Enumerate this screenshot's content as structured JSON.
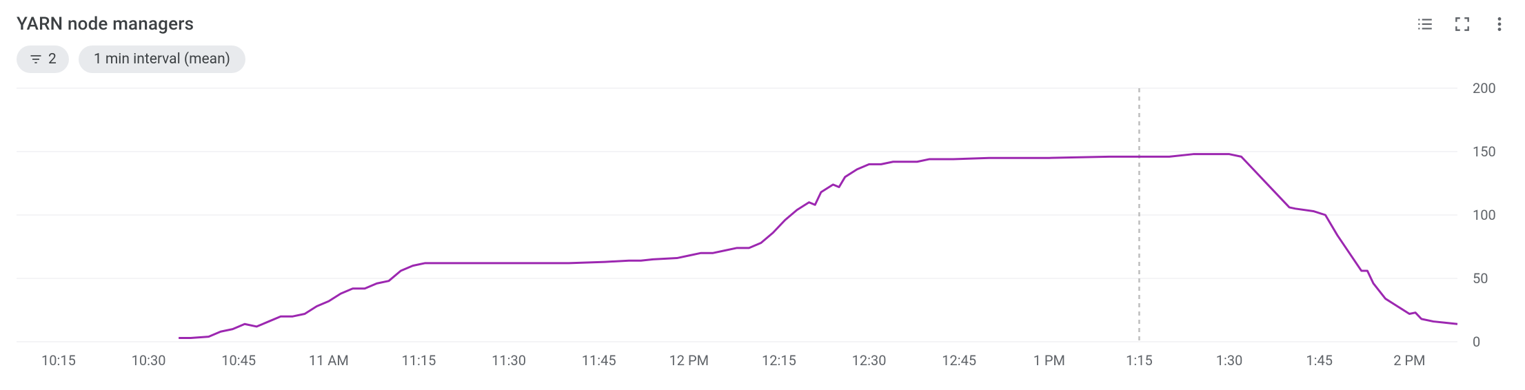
{
  "header": {
    "title": "YARN node managers"
  },
  "chips": {
    "filter_count": "2",
    "interval_label": "1 min interval (mean)"
  },
  "icons": {
    "legend": "legend-icon",
    "fullscreen": "fullscreen-icon",
    "more": "more-vert-icon"
  },
  "colors": {
    "series": "#9c27b0",
    "grid": "#e8eaed",
    "axis_text": "#5f6368"
  },
  "chart_data": {
    "type": "line",
    "title": "YARN node managers",
    "xlabel": "",
    "ylabel": "",
    "ylim": [
      0,
      200
    ],
    "y_ticks": [
      0,
      50,
      100,
      150,
      200
    ],
    "x_ticks": [
      "10:15",
      "10:30",
      "10:45",
      "11 AM",
      "11:15",
      "11:30",
      "11:45",
      "12 PM",
      "12:15",
      "12:30",
      "12:45",
      "1 PM",
      "1:15",
      "1:30",
      "1:45",
      "2 PM"
    ],
    "x_range_minutes": [
      608,
      848
    ],
    "marker_x_minute": 795,
    "series": [
      {
        "name": "node_managers",
        "color": "#9c27b0",
        "points": [
          [
            635,
            3
          ],
          [
            637,
            3
          ],
          [
            640,
            4
          ],
          [
            642,
            8
          ],
          [
            644,
            10
          ],
          [
            646,
            14
          ],
          [
            648,
            12
          ],
          [
            650,
            16
          ],
          [
            652,
            20
          ],
          [
            654,
            20
          ],
          [
            656,
            22
          ],
          [
            658,
            28
          ],
          [
            660,
            32
          ],
          [
            662,
            38
          ],
          [
            664,
            42
          ],
          [
            666,
            42
          ],
          [
            668,
            46
          ],
          [
            670,
            48
          ],
          [
            672,
            56
          ],
          [
            674,
            60
          ],
          [
            676,
            62
          ],
          [
            680,
            62
          ],
          [
            700,
            62
          ],
          [
            706,
            63
          ],
          [
            710,
            64
          ],
          [
            712,
            64
          ],
          [
            714,
            65
          ],
          [
            718,
            66
          ],
          [
            720,
            68
          ],
          [
            722,
            70
          ],
          [
            724,
            70
          ],
          [
            726,
            72
          ],
          [
            728,
            74
          ],
          [
            730,
            74
          ],
          [
            732,
            78
          ],
          [
            734,
            86
          ],
          [
            736,
            96
          ],
          [
            738,
            104
          ],
          [
            740,
            110
          ],
          [
            741,
            108
          ],
          [
            742,
            118
          ],
          [
            744,
            124
          ],
          [
            745,
            122
          ],
          [
            746,
            130
          ],
          [
            748,
            136
          ],
          [
            750,
            140
          ],
          [
            752,
            140
          ],
          [
            754,
            142
          ],
          [
            758,
            142
          ],
          [
            760,
            144
          ],
          [
            764,
            144
          ],
          [
            770,
            145
          ],
          [
            780,
            145
          ],
          [
            790,
            146
          ],
          [
            800,
            146
          ],
          [
            804,
            148
          ],
          [
            808,
            148
          ],
          [
            810,
            148
          ],
          [
            812,
            146
          ],
          [
            814,
            136
          ],
          [
            816,
            126
          ],
          [
            818,
            116
          ],
          [
            820,
            106
          ],
          [
            821,
            105
          ],
          [
            824,
            103
          ],
          [
            826,
            100
          ],
          [
            828,
            84
          ],
          [
            830,
            70
          ],
          [
            832,
            56
          ],
          [
            833,
            56
          ],
          [
            834,
            46
          ],
          [
            836,
            34
          ],
          [
            838,
            28
          ],
          [
            840,
            22
          ],
          [
            841,
            23
          ],
          [
            842,
            18
          ],
          [
            844,
            16
          ],
          [
            846,
            15
          ],
          [
            848,
            14
          ]
        ]
      }
    ]
  }
}
